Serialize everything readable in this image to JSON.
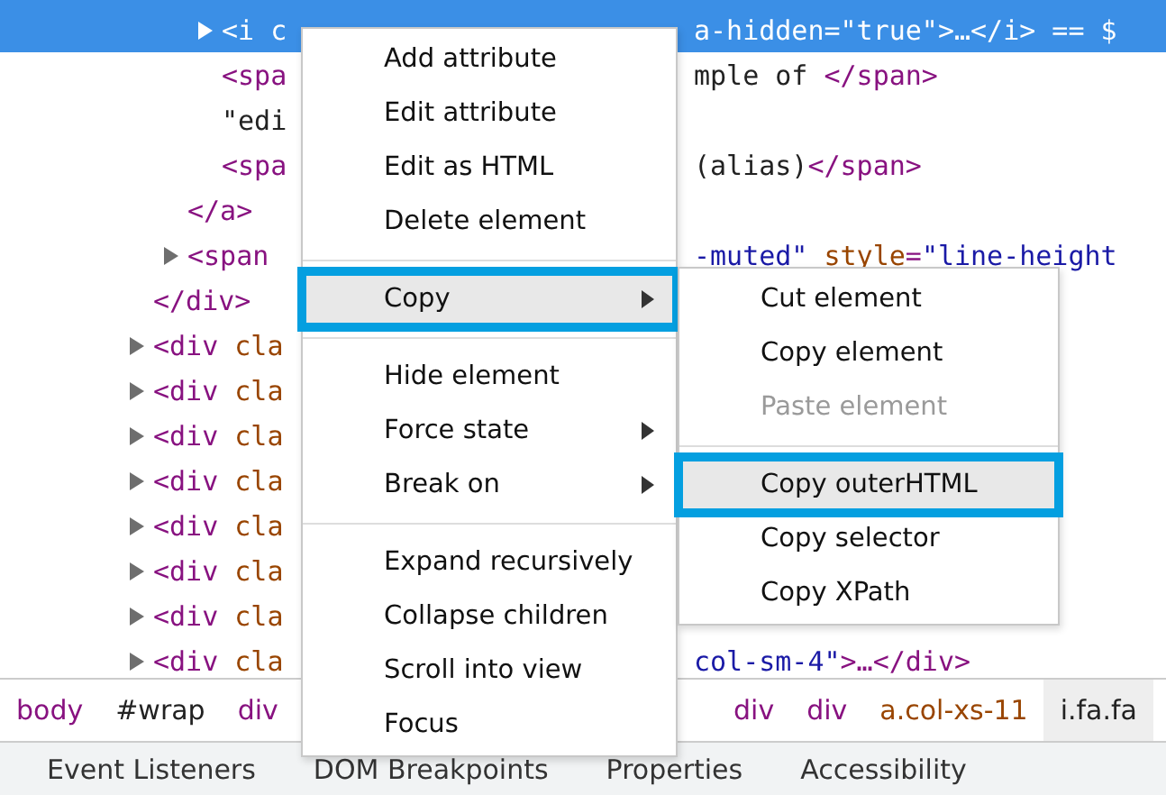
{
  "dom_tree": [
    {
      "children": [
        {
          "children": [
            {
              "expandable": true,
              "selected": true,
              "left": [
                {
                  "kind": "tag",
                  "text": "<i c"
                }
              ],
              "right": [
                {
                  "kind": "attr",
                  "text": "a-hidden"
                },
                {
                  "kind": "tag",
                  "text": "="
                },
                {
                  "kind": "value",
                  "text": "\"true\""
                },
                {
                  "kind": "tag",
                  "text": ">…</i>"
                },
                {
                  "kind": "text",
                  "text": " == $"
                }
              ]
            },
            {
              "expandable": false,
              "selected": false,
              "left": [
                {
                  "kind": "tag",
                  "text": "<spa"
                }
              ],
              "right": [
                {
                  "kind": "text",
                  "text": "mple of "
                },
                {
                  "kind": "tag",
                  "text": "</span>"
                }
              ]
            },
            {
              "expandable": false,
              "selected": false,
              "left": [
                {
                  "kind": "text",
                  "text": "\"edi"
                }
              ]
            },
            {
              "expandable": false,
              "selected": false,
              "left": [
                {
                  "kind": "tag",
                  "text": "<spa"
                }
              ],
              "right": [
                {
                  "kind": "text",
                  "text": "(alias)"
                },
                {
                  "kind": "tag",
                  "text": "</span>"
                }
              ]
            }
          ]
        },
        {
          "expandable": false,
          "selected": false,
          "left": [
            {
              "kind": "tag",
              "text": "</a>"
            }
          ]
        },
        {
          "expandable": true,
          "selected": false,
          "left": [
            {
              "kind": "tag",
              "text": "<span"
            }
          ],
          "right": [
            {
              "kind": "value",
              "text": "-muted\""
            },
            {
              "kind": "attr",
              "text": " style"
            },
            {
              "kind": "tag",
              "text": "="
            },
            {
              "kind": "value",
              "text": "\"line-height"
            }
          ]
        }
      ]
    },
    {
      "expandable": false,
      "selected": false,
      "left": [
        {
          "kind": "tag",
          "text": "</div>"
        }
      ]
    },
    {
      "expandable": true,
      "selected": false,
      "left": [
        {
          "kind": "tag",
          "text": "<div"
        },
        {
          "kind": "attr",
          "text": " cla"
        }
      ]
    },
    {
      "expandable": true,
      "selected": false,
      "left": [
        {
          "kind": "tag",
          "text": "<div"
        },
        {
          "kind": "attr",
          "text": " cla"
        }
      ]
    },
    {
      "expandable": true,
      "selected": false,
      "left": [
        {
          "kind": "tag",
          "text": "<div"
        },
        {
          "kind": "attr",
          "text": " cla"
        }
      ]
    },
    {
      "expandable": true,
      "selected": false,
      "left": [
        {
          "kind": "tag",
          "text": "<div"
        },
        {
          "kind": "attr",
          "text": " cla"
        }
      ]
    },
    {
      "expandable": true,
      "selected": false,
      "left": [
        {
          "kind": "tag",
          "text": "<div"
        },
        {
          "kind": "attr",
          "text": " cla"
        }
      ]
    },
    {
      "expandable": true,
      "selected": false,
      "left": [
        {
          "kind": "tag",
          "text": "<div"
        },
        {
          "kind": "attr",
          "text": " cla"
        }
      ]
    },
    {
      "expandable": true,
      "selected": false,
      "left": [
        {
          "kind": "tag",
          "text": "<div"
        },
        {
          "kind": "attr",
          "text": " cla"
        }
      ]
    },
    {
      "expandable": true,
      "selected": false,
      "left": [
        {
          "kind": "tag",
          "text": "<div"
        },
        {
          "kind": "attr",
          "text": " cla"
        }
      ],
      "right": [
        {
          "kind": "value",
          "text": "col-sm-4\""
        },
        {
          "kind": "tag",
          "text": ">…</div>"
        }
      ]
    }
  ],
  "breadcrumbs_left": [
    {
      "kind": "tag",
      "text": "body",
      "selected": false
    },
    {
      "kind": "id",
      "text": "#wrap",
      "selected": false
    },
    {
      "kind": "tag",
      "text": "div",
      "selected": false
    }
  ],
  "breadcrumbs_right": [
    {
      "kind": "tag",
      "text": "div",
      "selected": false
    },
    {
      "kind": "tag",
      "text": "div",
      "selected": false
    },
    {
      "kind": "class",
      "text": "a.col-xs-11",
      "selected": false
    },
    {
      "kind": "class",
      "text": "i.fa.fa",
      "selected": true
    }
  ],
  "context_menu": [
    {
      "kind": "item",
      "label": "Add attribute",
      "submenu": false,
      "highlighted": false,
      "outlined": false
    },
    {
      "kind": "item",
      "label": "Edit attribute",
      "submenu": false,
      "highlighted": false,
      "outlined": false
    },
    {
      "kind": "item",
      "label": "Edit as HTML",
      "submenu": false,
      "highlighted": false,
      "outlined": false
    },
    {
      "kind": "item",
      "label": "Delete element",
      "submenu": false,
      "highlighted": false,
      "outlined": false
    },
    {
      "kind": "separator"
    },
    {
      "kind": "item",
      "label": "Copy",
      "submenu": true,
      "highlighted": true,
      "outlined": true
    },
    {
      "kind": "separator"
    },
    {
      "kind": "item",
      "label": "Hide element",
      "submenu": false,
      "highlighted": false,
      "outlined": false
    },
    {
      "kind": "item",
      "label": "Force state",
      "submenu": true,
      "highlighted": false,
      "outlined": false
    },
    {
      "kind": "item",
      "label": "Break on",
      "submenu": true,
      "highlighted": false,
      "outlined": false
    },
    {
      "kind": "separator"
    },
    {
      "kind": "item",
      "label": "Expand recursively",
      "submenu": false,
      "highlighted": false,
      "outlined": false
    },
    {
      "kind": "item",
      "label": "Collapse children",
      "submenu": false,
      "highlighted": false,
      "outlined": false
    },
    {
      "kind": "item",
      "label": "Scroll into view",
      "submenu": false,
      "highlighted": false,
      "outlined": false
    },
    {
      "kind": "item",
      "label": "Focus",
      "submenu": false,
      "highlighted": false,
      "outlined": false
    }
  ],
  "copy_submenu": [
    {
      "kind": "item",
      "label": "Cut element",
      "disabled": false,
      "highlighted": false,
      "outlined": false
    },
    {
      "kind": "item",
      "label": "Copy element",
      "disabled": false,
      "highlighted": false,
      "outlined": false
    },
    {
      "kind": "item",
      "label": "Paste element",
      "disabled": true,
      "highlighted": false,
      "outlined": false
    },
    {
      "kind": "separator"
    },
    {
      "kind": "item",
      "label": "Copy outerHTML",
      "disabled": false,
      "highlighted": true,
      "outlined": true
    },
    {
      "kind": "item",
      "label": "Copy selector",
      "disabled": false,
      "highlighted": false,
      "outlined": false
    },
    {
      "kind": "item",
      "label": "Copy XPath",
      "disabled": false,
      "highlighted": false,
      "outlined": false
    }
  ],
  "bottom_tabs": [
    "Event Listeners",
    "DOM Breakpoints",
    "Properties",
    "Accessibility"
  ]
}
